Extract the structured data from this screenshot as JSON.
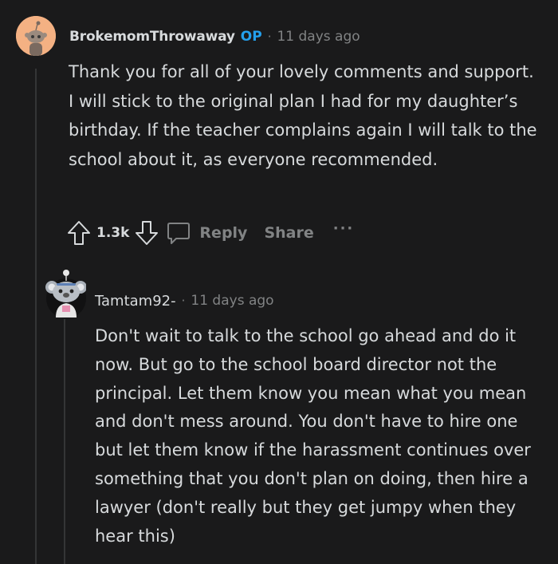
{
  "comment1": {
    "username": "BrokemomThrowaway",
    "op_badge": "OP",
    "separator": "·",
    "time": "11 days ago",
    "body": "Thank you for all of your lovely comments and support. I will stick to the original plan I had for my daughter’s birthday. If the teacher complains again I will talk to the school about it, as everyone recommended.",
    "avatar_icon": "snoo-avatar-icon",
    "actions": {
      "votes": "1.3k",
      "reply_label": "Reply",
      "share_label": "Share",
      "more_label": "···"
    }
  },
  "comment2": {
    "username": "Tamtam92-",
    "separator": "·",
    "time": "11 days ago",
    "avatar_icon": "koala-avatar-icon",
    "body": "Don't wait to talk to the school go ahead and do it now. But go to the school board director not the principal. Let them know you mean what you mean and don't mess around. You don't have to hire one but let them know if the harassment continues over something that you don't plan on doing, then hire a lawyer (don't really but they get jumpy when they hear this)"
  },
  "colors": {
    "background": "#1a1a1b",
    "text": "#d7dadc",
    "muted": "#818384",
    "op_blue": "#24a0ed",
    "thread_line": "#343536"
  }
}
